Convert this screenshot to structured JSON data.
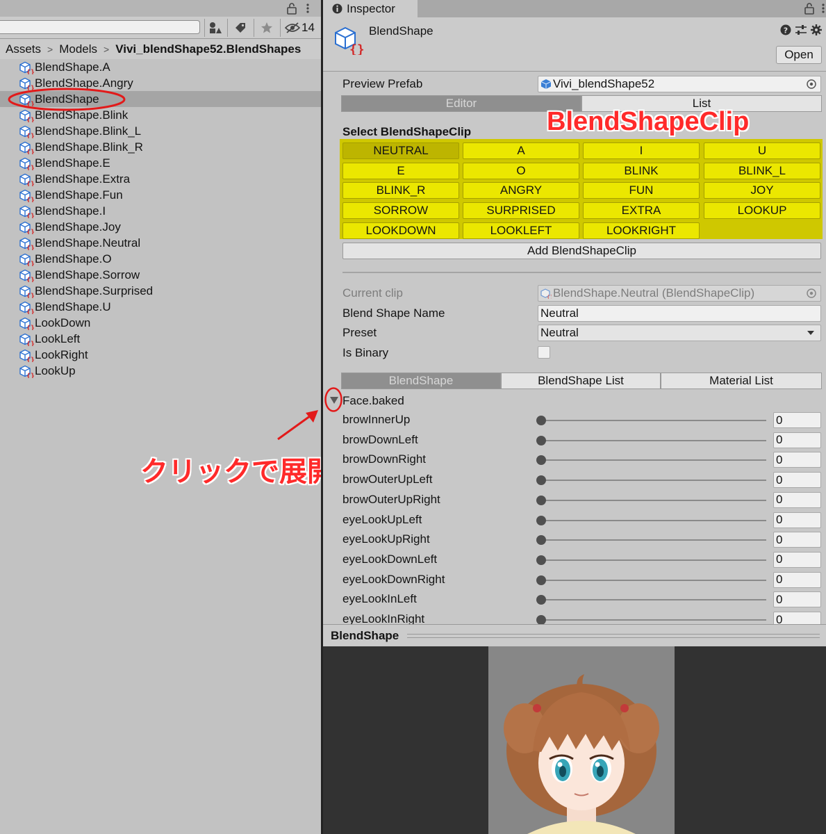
{
  "project": {
    "hidden_count": "14",
    "breadcrumb": [
      "Assets",
      "Models",
      "Vivi_blendShape52.BlendShapes"
    ],
    "items": [
      {
        "label": "BlendShape.A"
      },
      {
        "label": "BlendShape.Angry"
      },
      {
        "label": "BlendShape"
      },
      {
        "label": "BlendShape.Blink"
      },
      {
        "label": "BlendShape.Blink_L"
      },
      {
        "label": "BlendShape.Blink_R"
      },
      {
        "label": "BlendShape.E"
      },
      {
        "label": "BlendShape.Extra"
      },
      {
        "label": "BlendShape.Fun"
      },
      {
        "label": "BlendShape.I"
      },
      {
        "label": "BlendShape.Joy"
      },
      {
        "label": "BlendShape.Neutral"
      },
      {
        "label": "BlendShape.O"
      },
      {
        "label": "BlendShape.Sorrow"
      },
      {
        "label": "BlendShape.Surprised"
      },
      {
        "label": "BlendShape.U"
      },
      {
        "label": "LookDown"
      },
      {
        "label": "LookLeft"
      },
      {
        "label": "LookRight"
      },
      {
        "label": "LookUp"
      }
    ],
    "selected_index": 2
  },
  "inspector": {
    "tab_label": "Inspector",
    "object_name": "BlendShape",
    "open_label": "Open",
    "preview_prefab_label": "Preview Prefab",
    "preview_prefab_value": "Vivi_blendShape52",
    "mode_tabs": [
      "Editor",
      "List"
    ],
    "active_mode": 0,
    "select_clip_label": "Select BlendShapeClip",
    "clips": [
      "NEUTRAL",
      "A",
      "I",
      "U",
      "E",
      "O",
      "BLINK",
      "BLINK_L",
      "BLINK_R",
      "ANGRY",
      "FUN",
      "JOY",
      "SORROW",
      "SURPRISED",
      "EXTRA",
      "LOOKUP",
      "LOOKDOWN",
      "LOOKLEFT",
      "LOOKRIGHT"
    ],
    "selected_clip": 0,
    "add_clip_label": "Add BlendShapeClip",
    "current_clip_label": "Current clip",
    "current_clip_value": "BlendShape.Neutral (BlendShapeClip)",
    "blend_shape_name_label": "Blend Shape Name",
    "blend_shape_name_value": "Neutral",
    "preset_label": "Preset",
    "preset_value": "Neutral",
    "is_binary_label": "Is Binary",
    "is_binary": false,
    "sub_tabs": [
      "BlendShape",
      "BlendShape List",
      "Material List"
    ],
    "active_sub_tab": 0,
    "mesh_name": "Face.baked",
    "sliders": [
      {
        "name": "browInnerUp",
        "value": "0"
      },
      {
        "name": "browDownLeft",
        "value": "0"
      },
      {
        "name": "browDownRight",
        "value": "0"
      },
      {
        "name": "browOuterUpLeft",
        "value": "0"
      },
      {
        "name": "browOuterUpRight",
        "value": "0"
      },
      {
        "name": "eyeLookUpLeft",
        "value": "0"
      },
      {
        "name": "eyeLookUpRight",
        "value": "0"
      },
      {
        "name": "eyeLookDownLeft",
        "value": "0"
      },
      {
        "name": "eyeLookDownRight",
        "value": "0"
      },
      {
        "name": "eyeLookInLeft",
        "value": "0"
      },
      {
        "name": "eyeLookInRight",
        "value": "0"
      }
    ],
    "preview_title": "BlendShape"
  },
  "annotations": {
    "clip_title": "BlendShapeClip",
    "expand_note": "クリックで展開"
  },
  "colors": {
    "annotation_red": "#ff2a2a",
    "clip_yellow": "#ebe700",
    "clip_grid_bg": "#cfc800",
    "selected_clip": "#bdb500"
  },
  "icons": [
    "lock-icon",
    "menu-icon",
    "scene-filter-icon",
    "label-icon",
    "favorite-star-icon",
    "hidden-eye-icon",
    "info-icon",
    "blendshape-asset-icon",
    "help-icon",
    "settings-sliders-icon",
    "gear-icon",
    "object-picker-icon",
    "dropdown-arrow-icon",
    "foldout-arrow-icon",
    "prefab-cube-icon"
  ]
}
